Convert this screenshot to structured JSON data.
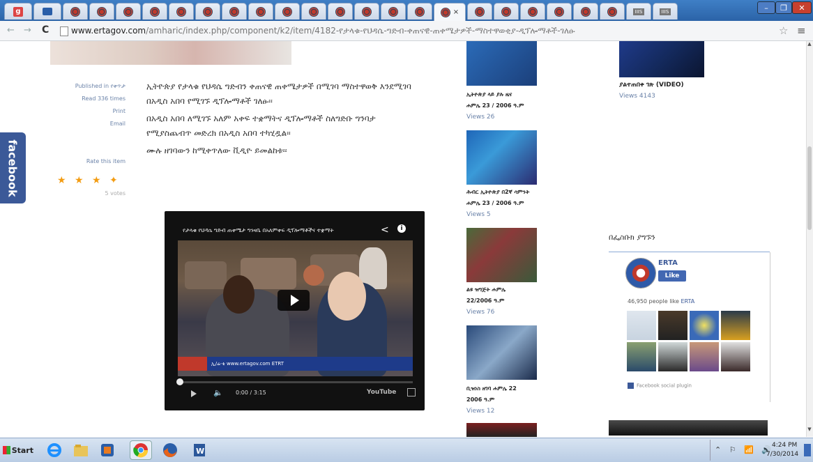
{
  "browser": {
    "tabs": [
      {
        "favicon": "google-plus-icon",
        "label": "g"
      },
      {
        "favicon": "gmail-icon"
      },
      {
        "favicon": "erta-icon"
      },
      {
        "favicon": "erta-icon"
      },
      {
        "favicon": "erta-icon"
      },
      {
        "favicon": "erta-icon"
      },
      {
        "favicon": "erta-icon"
      },
      {
        "favicon": "erta-icon"
      },
      {
        "favicon": "erta-icon"
      },
      {
        "favicon": "erta-icon"
      },
      {
        "favicon": "erta-icon"
      },
      {
        "favicon": "erta-icon"
      },
      {
        "favicon": "erta-icon"
      },
      {
        "favicon": "erta-icon"
      },
      {
        "favicon": "erta-icon"
      },
      {
        "favicon": "erta-icon"
      },
      {
        "favicon": "erta-icon",
        "active": true,
        "close": "×"
      },
      {
        "favicon": "erta-icon"
      },
      {
        "favicon": "erta-icon"
      },
      {
        "favicon": "erta-icon"
      },
      {
        "favicon": "erta-icon"
      },
      {
        "favicon": "erta-icon"
      },
      {
        "favicon": "erta-icon"
      },
      {
        "favicon": "box-icon",
        "label": "IIIS"
      },
      {
        "favicon": "box-icon",
        "label": "IIIS"
      }
    ],
    "window_buttons": {
      "minimize": "–",
      "maximize": "❐",
      "close": "✕"
    },
    "url_host": "www.ertagov.com",
    "url_path": "/amharic/index.php/component/k2/item/4182-የታላቁ-የህዳሴ-ግድብ-ቀጠናዊ-ጠቀሜታዎች-ማስተዋወቂያ-ዲፕሎማቶች-ገለፁ",
    "back": "←",
    "forward": "→",
    "reload": "C",
    "star": "☆",
    "menu": "≡"
  },
  "sidebar": {
    "facebook_label": "facebook"
  },
  "article_meta": {
    "published": "Published in የቀጥታ",
    "read": "Read 336 times",
    "print": "Print",
    "email": "Email",
    "rate": "Rate this item",
    "votes": "5 votes",
    "stars": "★ ★ ★ ✦"
  },
  "article": {
    "p1": "ኢትዮጵያ የታላቁ የህዳሴ ግድብን ቀጠናዊ ጠቀሜታዎች በሚገባ ማስተዋወቅ እንደሚገባ በአዲስ አበባ የሚገኙ ዲፕሎማቶች ገለፁ፡፡",
    "p2": "በአዲስ አበባ ለሚገኙ አለም አቀፍ ተቋማትና ዲፕሎማቶች ስለግድቡ ግንባታ የሚያስጨብጥ መድረክ በአዲስ አበባ ተካሂዷል፡፡",
    "p3": "ሙሉ ዘገባውን ከሚቀጥለው ቪዲዮ ይመልከቱ፡፡"
  },
  "video": {
    "title": "የታላቁ የህዳሴ ግድብ ጠቀሜታ ግንዛቤ በአለምቀፍ ዲፕሎማቶችና ተቋማት",
    "share_icon": "share-icon",
    "info": "i",
    "ticker": "ኢ/ሬ·ቴ  www.ertagov.com  ETRT",
    "time": "0:00 / 3:15",
    "youtube": "YouTube",
    "volume": "🔈"
  },
  "related": [
    {
      "title": "ኢትዮጵያ ላይ ያሉ ዜና",
      "date": "ሐምሌ 23 / 2006 ዓ.ም",
      "views": "Views  26"
    },
    {
      "title": "ሕብር ኢትዮጵያ በ2ኛ ሳምንት",
      "date": "ሐምሌ 23 / 2006 ዓ.ም",
      "views": "Views  5"
    },
    {
      "title": "ልዩ ዝግጅት ሐምሌ",
      "date": "22/2006 ዓ.ም",
      "views": "Views  76"
    },
    {
      "title": "ቢዝነስ ዘገባ ሐምሌ 22",
      "date": "2006 ዓ.ም",
      "views": "Views  12"
    }
  ],
  "right_item": {
    "title": "ያልተጠበቀ ገጽ (VIDEO)",
    "views": "Views  4143"
  },
  "facebook_box": {
    "heading": "በፌስቡክ ያግኙን",
    "page_name": "ERTA",
    "like": "Like",
    "count_prefix": "46,950 people like ",
    "count_link": "ERTA",
    "plugin": "Facebook social plugin"
  },
  "taskbar": {
    "start": "Start",
    "apps": [
      "ie-icon",
      "explorer-icon",
      "media-player-icon",
      "chrome-icon",
      "firefox-icon",
      "word-icon"
    ],
    "time": "4:24 PM",
    "date": "7/30/2014",
    "tray": "⌃ ⚐ 📶 🔊"
  }
}
